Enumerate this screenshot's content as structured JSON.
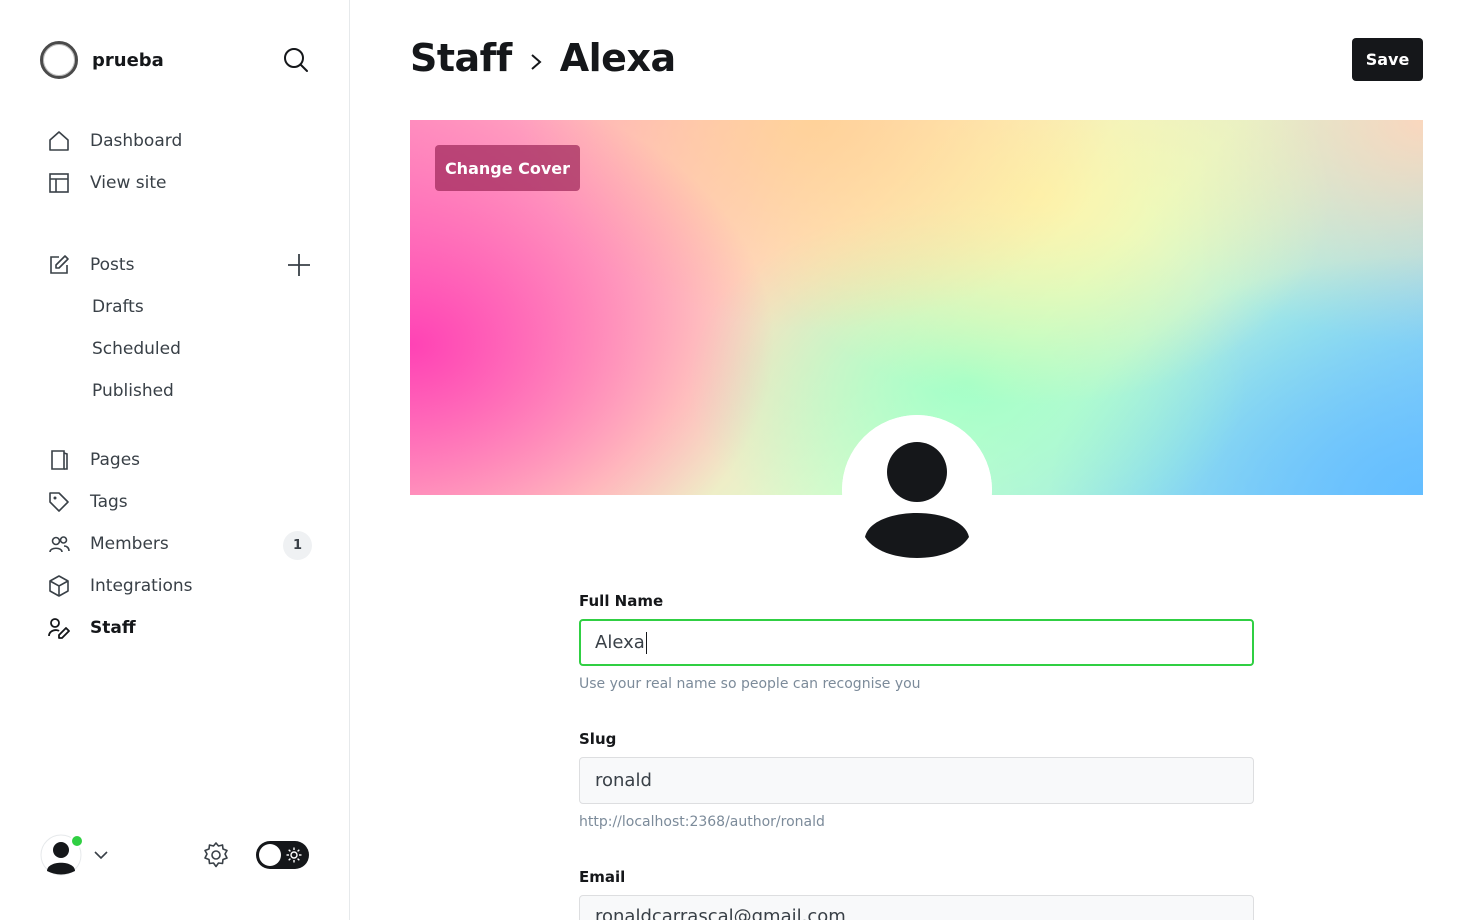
{
  "sidebar": {
    "site_name": "prueba",
    "nav": {
      "dashboard": "Dashboard",
      "view_site": "View site",
      "posts": "Posts",
      "drafts": "Drafts",
      "scheduled": "Scheduled",
      "published": "Published",
      "pages": "Pages",
      "tags": "Tags",
      "members": "Members",
      "members_count": "1",
      "integrations": "Integrations",
      "staff": "Staff"
    },
    "icons": {
      "search": "search-icon",
      "plus": "plus-icon",
      "gear": "gear-icon",
      "theme_toggle": "sun-icon"
    }
  },
  "header": {
    "breadcrumb_parent": "Staff",
    "breadcrumb_current": "Alexa",
    "save_label": "Save"
  },
  "cover": {
    "change_cover_label": "Change Cover"
  },
  "form": {
    "full_name": {
      "label": "Full Name",
      "value": "Alexa",
      "hint": "Use your real name so people can recognise you"
    },
    "slug": {
      "label": "Slug",
      "value": "ronald",
      "hint": "http://localhost:2368/author/ronald"
    },
    "email": {
      "label": "Email",
      "value": "ronaldcarrascal@gmail.com"
    }
  },
  "colors": {
    "accent_green": "#30cf43",
    "dark": "#15171a"
  }
}
